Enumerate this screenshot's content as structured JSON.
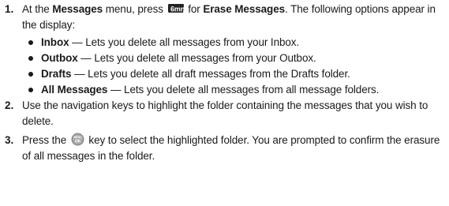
{
  "steps": [
    {
      "number": "1.",
      "pre_menu": "At the ",
      "menu_name": "Messages",
      "post_menu": " menu, press ",
      "key_label": "6mno",
      "post_key": " for ",
      "option_name": "Erase Messages",
      "post_option": ". The following options appear in the display:",
      "bullets": [
        {
          "term": "Inbox",
          "desc": " — Lets you delete all messages from your Inbox."
        },
        {
          "term": "Outbox",
          "desc": " — Lets you delete all messages from your Outbox."
        },
        {
          "term": "Drafts",
          "desc": " — Lets you delete all draft messages from the Drafts folder."
        },
        {
          "term": "All Messages",
          "desc": " — Lets you delete all messages from all message folders."
        }
      ]
    },
    {
      "number": "2.",
      "text": "Use the navigation keys to highlight the folder containing the messages that you wish to delete."
    },
    {
      "number": "3.",
      "pre_key": "Press the ",
      "key_label_top": "MENU",
      "key_label_bottom": "OK",
      "post_key": " key to select the highlighted folder. You are prompted to confirm the erasure of all messages in the folder."
    }
  ]
}
